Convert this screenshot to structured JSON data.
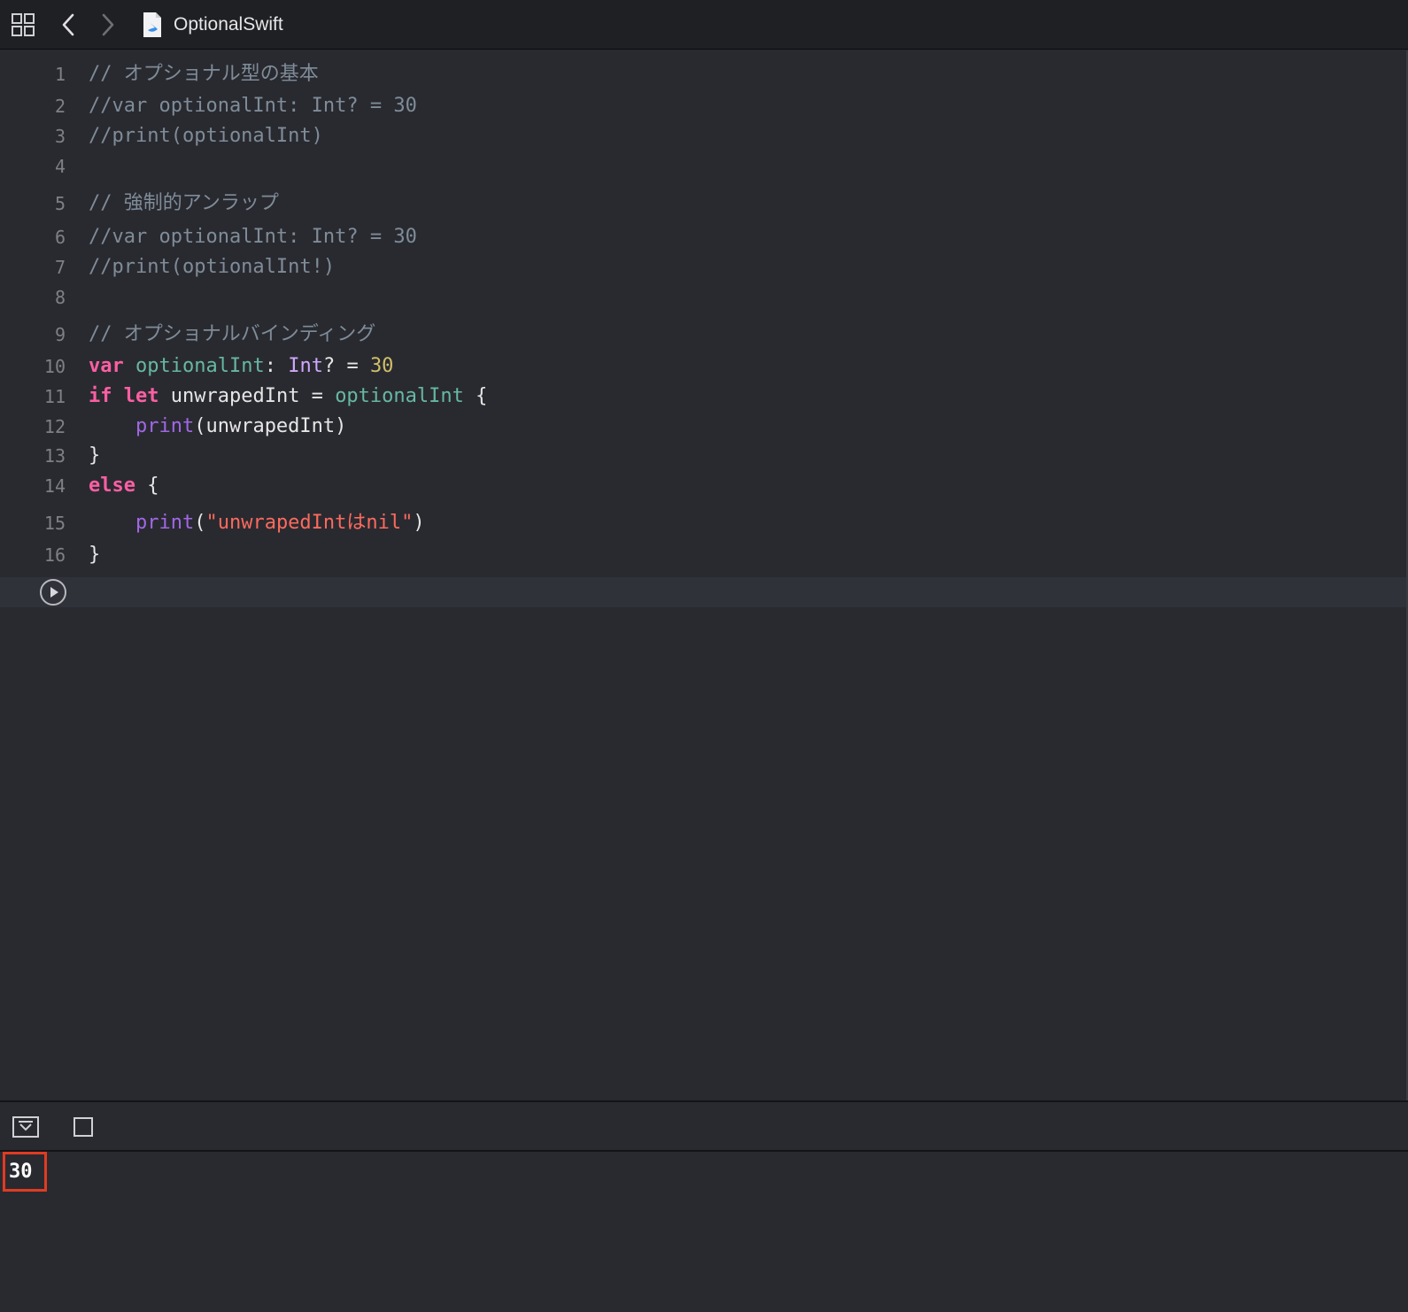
{
  "toolbar": {
    "file_name": "OptionalSwift",
    "icons": {
      "grid": "grid-icon",
      "back": "chevron-left-icon",
      "forward": "chevron-right-icon",
      "file": "swift-file-icon"
    }
  },
  "editor": {
    "lines": [
      {
        "number": "1",
        "tokens": [
          {
            "t": "// オプショナル型の基本",
            "c": "comment"
          }
        ]
      },
      {
        "number": "2",
        "tokens": [
          {
            "t": "//var optionalInt: Int? = 30",
            "c": "comment"
          }
        ]
      },
      {
        "number": "3",
        "tokens": [
          {
            "t": "//print(optionalInt)",
            "c": "comment"
          }
        ]
      },
      {
        "number": "4",
        "tokens": []
      },
      {
        "number": "5",
        "tokens": [
          {
            "t": "// 強制的アンラップ",
            "c": "comment"
          }
        ]
      },
      {
        "number": "6",
        "tokens": [
          {
            "t": "//var optionalInt: Int? = 30",
            "c": "comment"
          }
        ]
      },
      {
        "number": "7",
        "tokens": [
          {
            "t": "//print(optionalInt!)",
            "c": "comment"
          }
        ]
      },
      {
        "number": "8",
        "tokens": []
      },
      {
        "number": "9",
        "tokens": [
          {
            "t": "// オプショナルバインディング",
            "c": "comment"
          }
        ]
      },
      {
        "number": "10",
        "tokens": [
          {
            "t": "var",
            "c": "kw"
          },
          {
            "t": " ",
            "c": "plain"
          },
          {
            "t": "optionalInt",
            "c": "decl"
          },
          {
            "t": ": ",
            "c": "plain"
          },
          {
            "t": "Int",
            "c": "typ"
          },
          {
            "t": "? = ",
            "c": "plain"
          },
          {
            "t": "30",
            "c": "num"
          }
        ]
      },
      {
        "number": "11",
        "tokens": [
          {
            "t": "if",
            "c": "kw"
          },
          {
            "t": " ",
            "c": "plain"
          },
          {
            "t": "let",
            "c": "kw"
          },
          {
            "t": " unwrapedInt = ",
            "c": "plain"
          },
          {
            "t": "optionalInt",
            "c": "decl"
          },
          {
            "t": " {",
            "c": "plain"
          }
        ]
      },
      {
        "number": "12",
        "tokens": [
          {
            "t": "    ",
            "c": "plain"
          },
          {
            "t": "print",
            "c": "fn"
          },
          {
            "t": "(unwrapedInt)",
            "c": "plain"
          }
        ]
      },
      {
        "number": "13",
        "tokens": [
          {
            "t": "}",
            "c": "plain"
          }
        ]
      },
      {
        "number": "14",
        "tokens": [
          {
            "t": "else",
            "c": "kw"
          },
          {
            "t": " {",
            "c": "plain"
          }
        ]
      },
      {
        "number": "15",
        "tokens": [
          {
            "t": "    ",
            "c": "plain"
          },
          {
            "t": "print",
            "c": "fn"
          },
          {
            "t": "(",
            "c": "plain"
          },
          {
            "t": "\"unwrapedIntはnil\"",
            "c": "str"
          },
          {
            "t": ")",
            "c": "plain"
          }
        ]
      },
      {
        "number": "16",
        "tokens": [
          {
            "t": "}",
            "c": "plain"
          }
        ]
      }
    ],
    "run_icon": "play-circle-icon"
  },
  "debug_bar": {
    "hide_icon": "hide-console-icon",
    "split_icon": "square-icon"
  },
  "console": {
    "output": "30"
  },
  "colors": {
    "background": "#292a30",
    "toolbar": "#1f2024",
    "highlight_border": "#e03b22"
  }
}
